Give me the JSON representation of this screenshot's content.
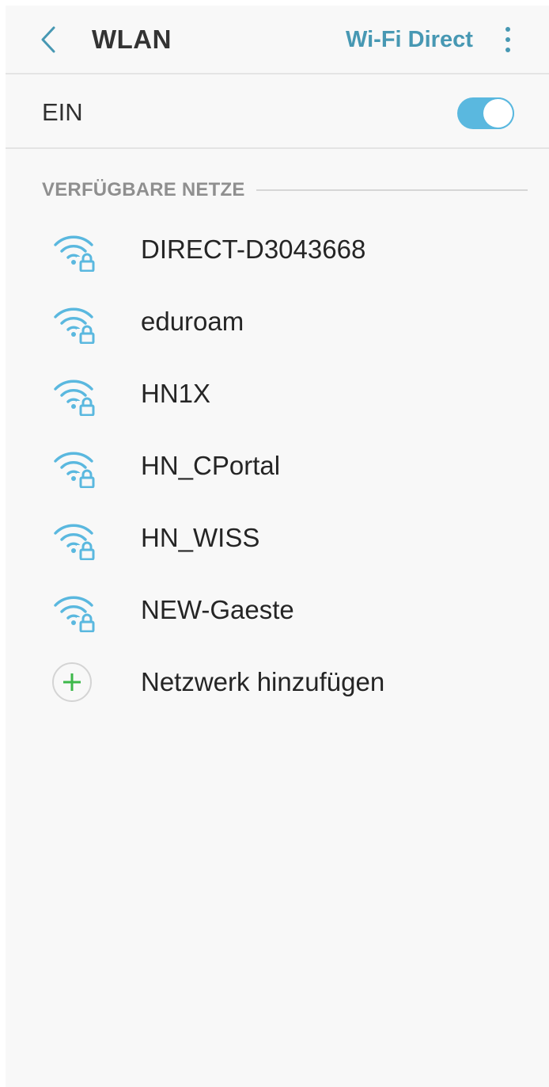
{
  "header": {
    "title": "WLAN",
    "wifi_direct_label": "Wi-Fi Direct",
    "back_icon": "chevron-left-icon",
    "more_icon": "more-vert-icon"
  },
  "toggle_row": {
    "label": "EIN",
    "enabled": true
  },
  "section": {
    "title": "VERFÜGBARE NETZE"
  },
  "networks": [
    {
      "name": "DIRECT-D3043668",
      "secured": true
    },
    {
      "name": "eduroam",
      "secured": true
    },
    {
      "name": "HN1X",
      "secured": true
    },
    {
      "name": "HN_CPortal",
      "secured": true
    },
    {
      "name": "HN_WISS",
      "secured": true
    },
    {
      "name": "NEW-Gaeste",
      "secured": true
    }
  ],
  "add_network": {
    "label": "Netzwerk hinzufügen"
  },
  "colors": {
    "accent": "#4798b3",
    "wifi_icon": "#5ab8df",
    "toggle_on": "#5ab8df",
    "add_plus": "#3db84a",
    "background": "#f8f8f8"
  }
}
